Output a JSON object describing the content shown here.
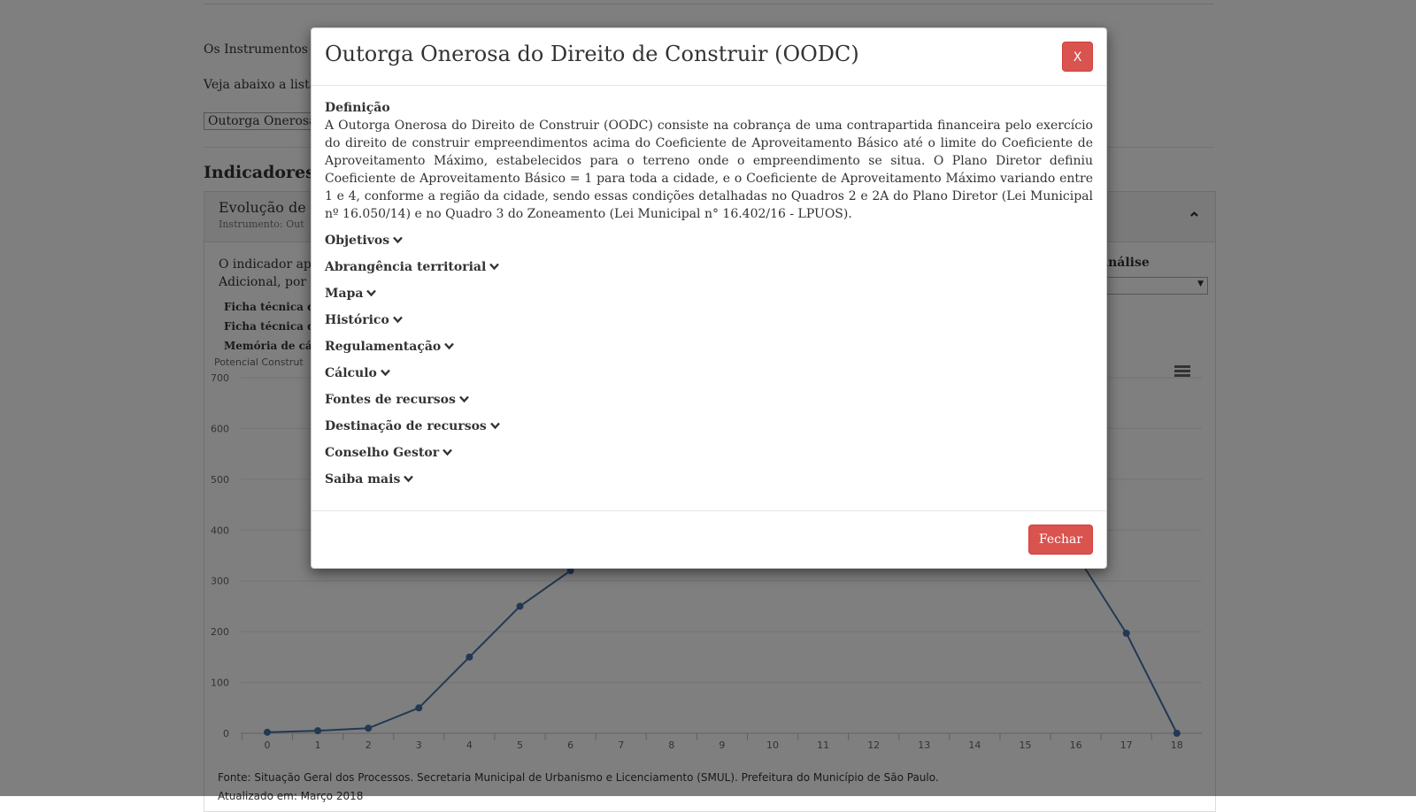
{
  "page": {
    "intro_line_1": "Os Instrumentos d",
    "intro_line_2": "Veja abaixo a lista",
    "instrument_select_value": "Outorga Onerosa",
    "section_heading": "Indicadores",
    "panel": {
      "title": "Evolução de u",
      "subtitle": "Instrumento: Out",
      "description_line_1": "O indicador apr",
      "description_line_2": "Adicional, por u",
      "ficha_1": "Ficha técnica do",
      "ficha_2": "Ficha técnica do",
      "memoria": "Memória de cálcu",
      "analise_label": "análise",
      "chart_axis_title": "Potencial Construt"
    },
    "footnote_source": "Fonte: Situação Geral dos Processos. Secretaria Municipal de Urbanismo e Licenciamento (SMUL). Prefeitura do Município de São Paulo.",
    "footnote_updated": "Atualizado em: Março 2018"
  },
  "chart_data": {
    "type": "line",
    "x": [
      0,
      1,
      2,
      3,
      4,
      5,
      6,
      7,
      8,
      9,
      10,
      11,
      12,
      13,
      14,
      15,
      16,
      17,
      18
    ],
    "y_ticks": [
      0,
      100,
      200,
      300,
      400,
      500,
      600,
      700
    ],
    "ylim": [
      0,
      700
    ],
    "grid": true,
    "visible_points": [
      {
        "x": 0,
        "y": 2
      },
      {
        "x": 1,
        "y": 5
      },
      {
        "x": 2,
        "y": 10
      },
      {
        "x": 3,
        "y": 50
      },
      {
        "x": 4,
        "y": 150
      },
      {
        "x": 5,
        "y": 250
      },
      {
        "x": 6,
        "y": 320
      },
      {
        "x": 17,
        "y": 197
      },
      {
        "x": 18,
        "y": 0
      }
    ],
    "line_color": "#4572a7"
  },
  "modal": {
    "title": "Outorga Onerosa do Direito de Construir (OODC)",
    "close_x_label": "X",
    "definition_heading": "Definição",
    "definition_text": "A Outorga Onerosa do Direito de Construir (OODC) consiste na cobrança de uma contrapartida financeira pelo exercício do direito de construir empreendimentos acima do Coeficiente de Aproveitamento Básico até o limite do Coeficiente de Aproveitamento Máximo, estabelecidos para o terreno onde o empreendimento se situa. O Plano Diretor definiu Coeficiente de Aproveitamento Básico = 1 para toda a cidade, e o Coeficiente de Aproveitamento Máximo variando entre 1 e 4, conforme a região da cidade, sendo essas condições detalhadas no Quadros 2 e 2A do Plano Diretor (Lei Municipal nº 16.050/14) e no Quadro 3 do Zoneamento (Lei Municipal n° 16.402/16 - LPUOS).",
    "sections": [
      {
        "label": "Objetivos",
        "icon": "chevron-down-icon"
      },
      {
        "label": "Abrangência territorial",
        "icon": "chevron-down-icon"
      },
      {
        "label": "Mapa",
        "icon": "chevron-down-icon"
      },
      {
        "label": "Histórico",
        "icon": "chevron-down-icon"
      },
      {
        "label": "Regulamentação",
        "icon": "chevron-down-icon"
      },
      {
        "label": "Cálculo",
        "icon": "chevron-down-icon"
      },
      {
        "label": "Fontes de recursos",
        "icon": "chevron-down-icon"
      },
      {
        "label": "Destinação de recursos",
        "icon": "chevron-down-icon"
      },
      {
        "label": "Conselho Gestor",
        "icon": "chevron-down-icon"
      },
      {
        "label": "Saiba mais",
        "icon": "chevron-down-icon"
      }
    ],
    "fechar_label": "Fechar"
  },
  "colors": {
    "danger": "#d9534f",
    "overlay": "rgba(0,0,0,0.5)",
    "series": "#4572a7"
  }
}
